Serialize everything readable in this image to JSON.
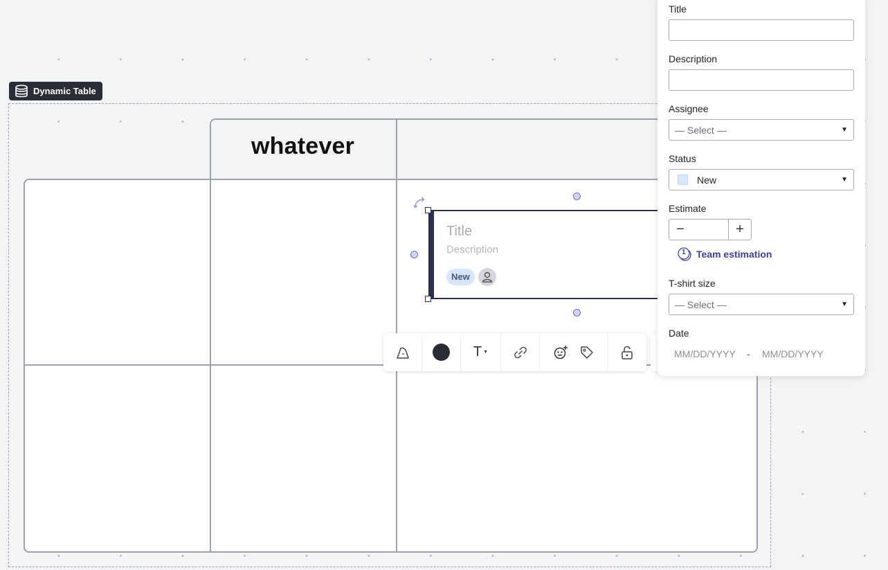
{
  "table": {
    "label": "Dynamic Table",
    "header_column": "whatever"
  },
  "card": {
    "title": "Title",
    "description": "Description",
    "status": "New"
  },
  "toolbar": {
    "items": [
      "shape-icon",
      "color-icon",
      "text-format-icon",
      "link-icon",
      "reaction-icon",
      "tag-icon",
      "lock-icon"
    ],
    "text_button": "T",
    "color": "#2b2d36"
  },
  "panel": {
    "title_label": "Title",
    "title_value": "",
    "description_label": "Description",
    "description_value": "",
    "assignee_label": "Assignee",
    "assignee_value": "— Select —",
    "status_label": "Status",
    "status_value": "New",
    "status_color": "#d7e6ff",
    "estimate_label": "Estimate",
    "estimate_value": "",
    "minus": "−",
    "plus": "+",
    "team_estimation": "Team estimation",
    "team_estimation_badge": "1",
    "tshirt_label": "T-shirt size",
    "tshirt_value": "— Select —",
    "date_label": "Date",
    "date_start_placeholder": "MM/DD/YYYY",
    "date_separator": "-",
    "date_end_placeholder": "MM/DD/YYYY"
  }
}
